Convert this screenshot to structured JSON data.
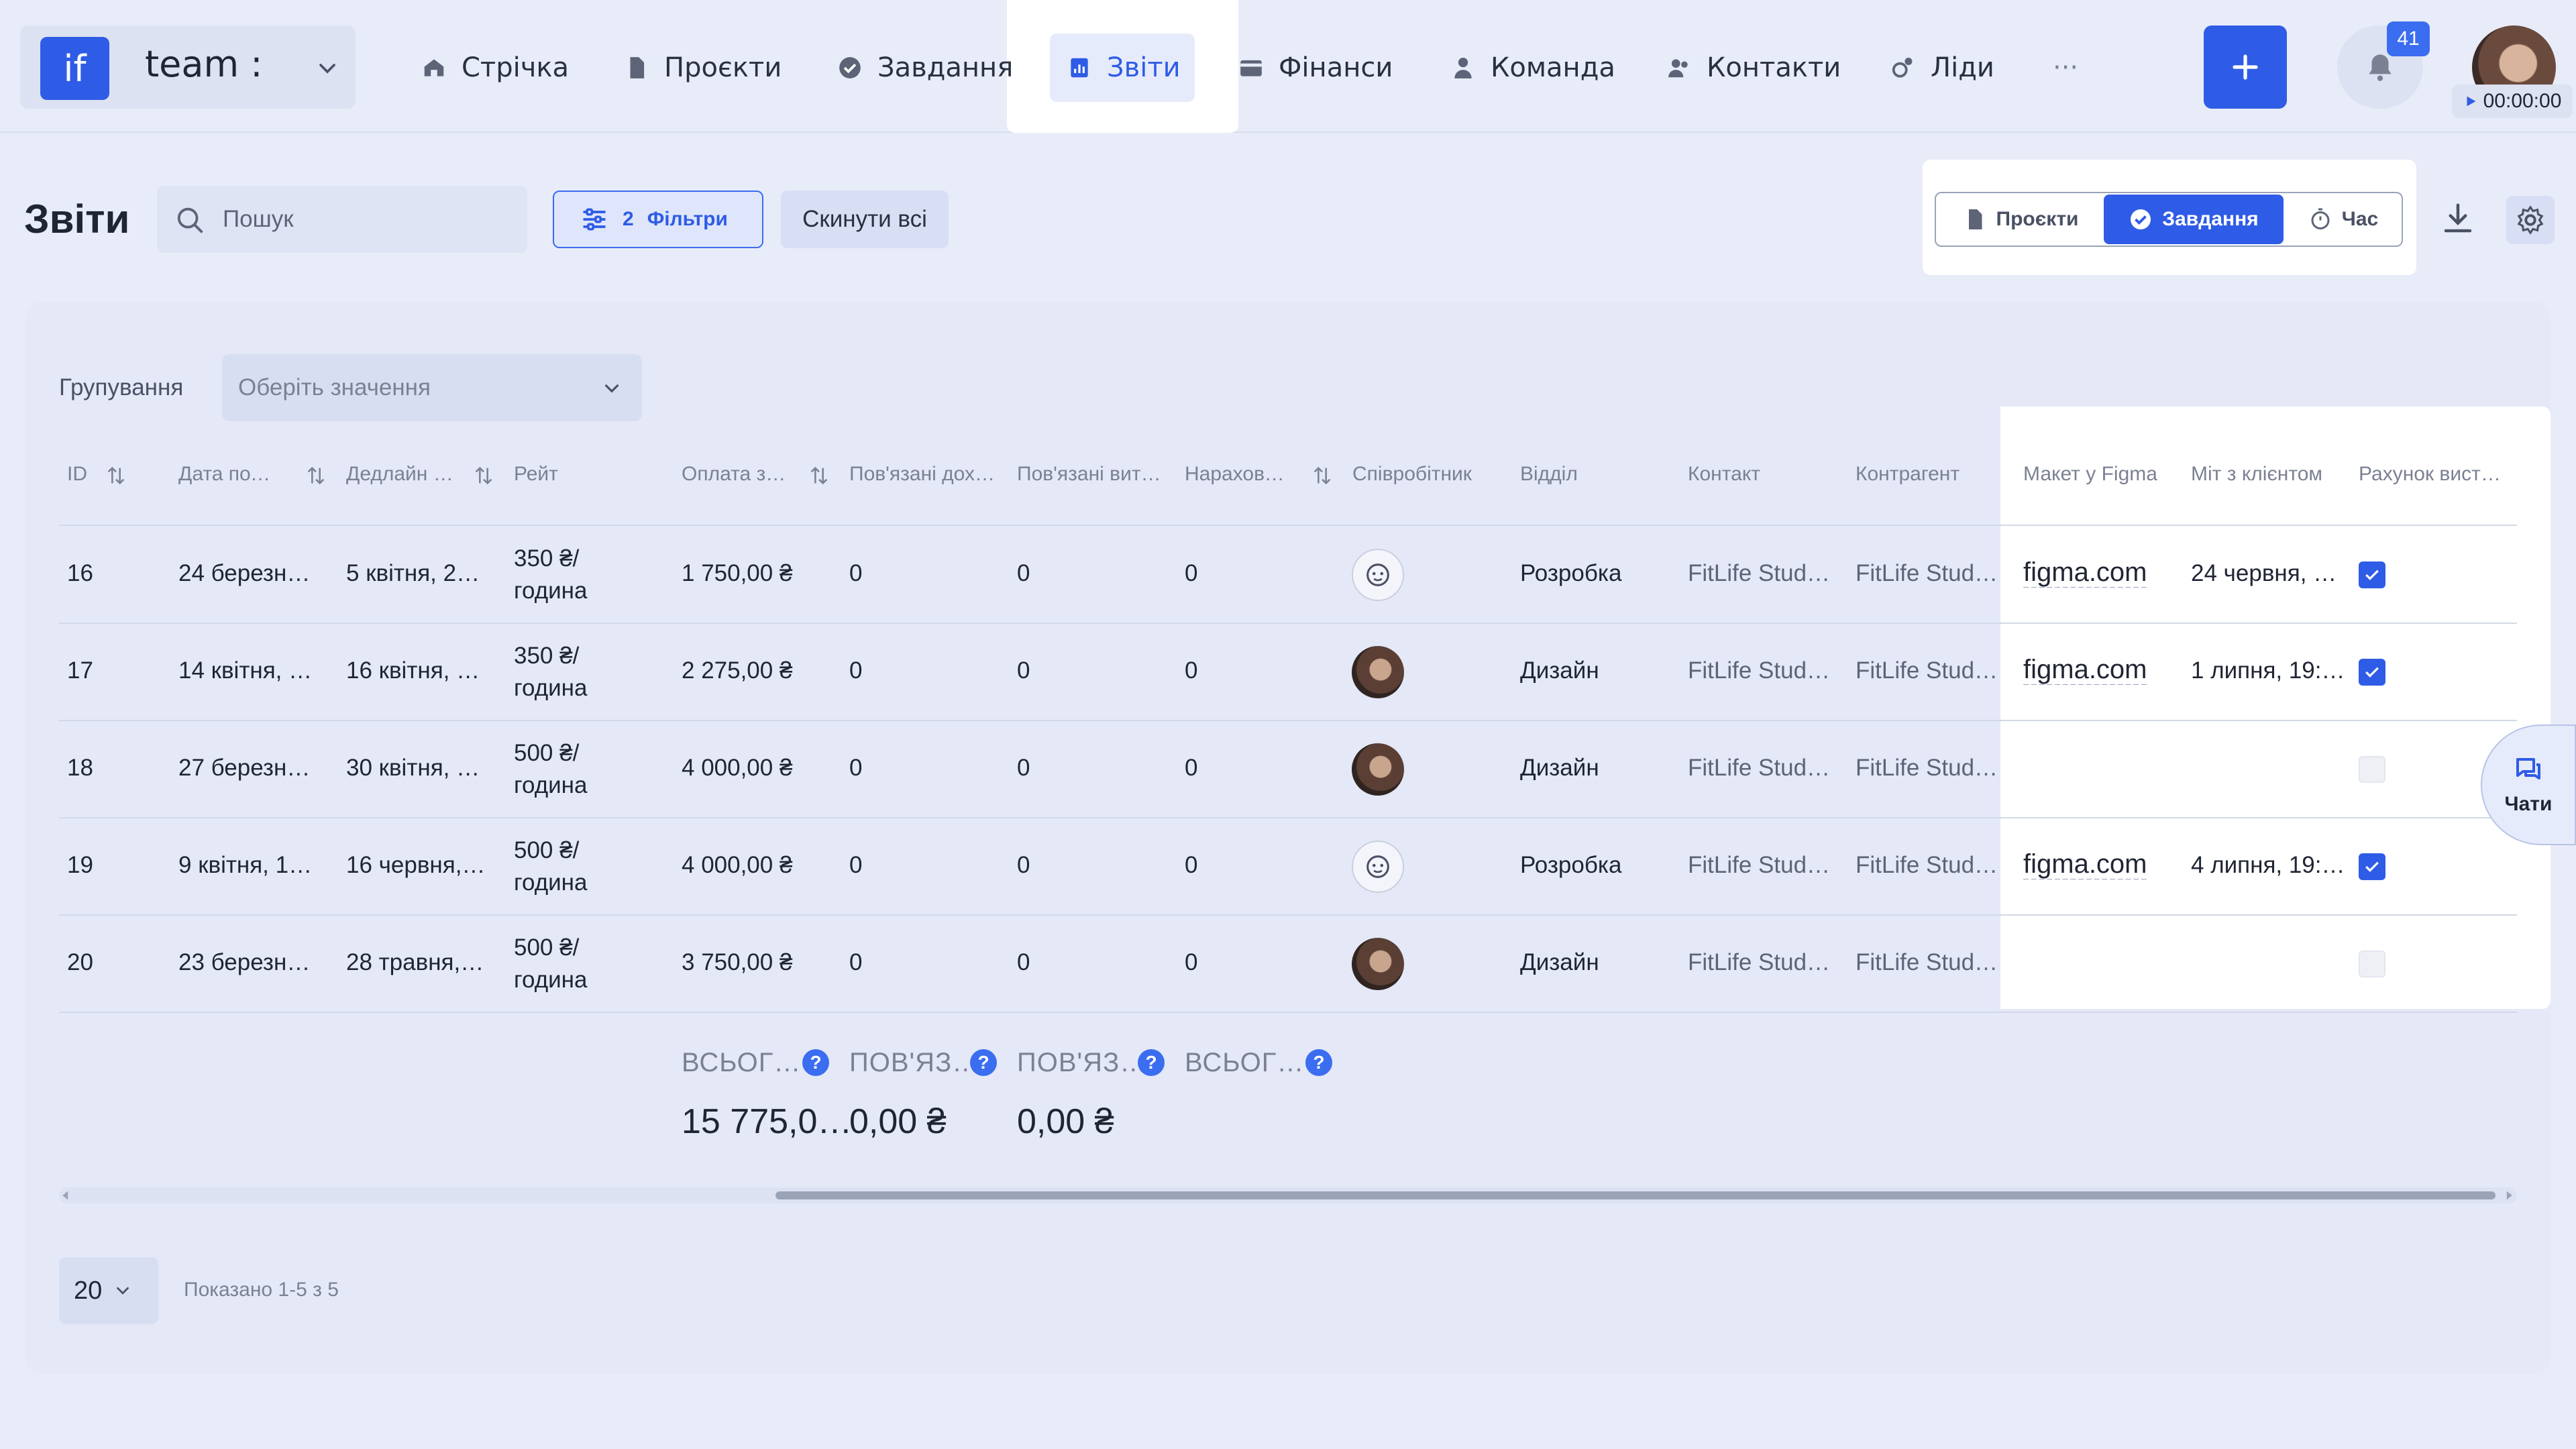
{
  "app": {
    "logo_text": "if",
    "team_name": "team :"
  },
  "nav": [
    {
      "label": "Стрічка",
      "icon": "home-icon"
    },
    {
      "label": "Проєкти",
      "icon": "document-icon"
    },
    {
      "label": "Завдання",
      "icon": "check-circle-icon"
    },
    {
      "label": "Звіти",
      "icon": "report-icon",
      "active": true
    },
    {
      "label": "Фінанси",
      "icon": "wallet-icon"
    },
    {
      "label": "Команда",
      "icon": "user-icon"
    },
    {
      "label": "Контакти",
      "icon": "contacts-icon"
    },
    {
      "label": "Ліди",
      "icon": "leads-icon"
    },
    {
      "label": "···",
      "icon": "more-icon"
    }
  ],
  "header": {
    "notifications_count": "41",
    "timer": "00:00:00"
  },
  "toolbar": {
    "title": "Звіти",
    "search_placeholder": "Пошук",
    "filters_count": "2",
    "filters_label": "Фільтри",
    "reset_label": "Скинути всі",
    "modes": [
      "Проєкти",
      "Завдання",
      "Час"
    ],
    "active_mode": "Завдання"
  },
  "grouping": {
    "label": "Групування",
    "placeholder": "Оберіть значення"
  },
  "table": {
    "columns": [
      "ID",
      "Дата поч…",
      "Дедлайн …",
      "Рейт",
      "Оплата з…",
      "Пов'язані дох…",
      "Пов'язані вит…",
      "Нарахова…",
      "Співробітник",
      "Відділ",
      "Контакт",
      "Контрагент",
      "Макет у Figma",
      "Міт з клієнтом",
      "Рахунок вист…"
    ],
    "rows": [
      {
        "id": "16",
        "start": "24 березня…",
        "deadline": "5 квітня, 2…",
        "rate1": "350 ₴/",
        "rate2": "година",
        "payment": "1 750,00 ₴",
        "income": "0",
        "expense": "0",
        "accrued": "0",
        "employee": "icon",
        "dept": "Розробка",
        "contact": "FitLife Stud…",
        "counterparty": "FitLife Stud…",
        "figma": "figma.com",
        "meeting": "24 червня, 1…",
        "invoiced": true
      },
      {
        "id": "17",
        "start": "14 квітня, 1…",
        "deadline": "16 квітня, 2…",
        "rate1": "350 ₴/",
        "rate2": "година",
        "payment": "2 275,00 ₴",
        "income": "0",
        "expense": "0",
        "accrued": "0",
        "employee": "photo",
        "dept": "Дизайн",
        "contact": "FitLife Stud…",
        "counterparty": "FitLife Stud…",
        "figma": "figma.com",
        "meeting": "1 липня, 19:…",
        "invoiced": true
      },
      {
        "id": "18",
        "start": "27 березня…",
        "deadline": "30 квітня, …",
        "rate1": "500 ₴/",
        "rate2": "година",
        "payment": "4 000,00 ₴",
        "income": "0",
        "expense": "0",
        "accrued": "0",
        "employee": "photo",
        "dept": "Дизайн",
        "contact": "FitLife Stud…",
        "counterparty": "FitLife Stud…",
        "figma": "",
        "meeting": "",
        "invoiced": false
      },
      {
        "id": "19",
        "start": "9 квітня, 16…",
        "deadline": "16 червня, …",
        "rate1": "500 ₴/",
        "rate2": "година",
        "payment": "4 000,00 ₴",
        "income": "0",
        "expense": "0",
        "accrued": "0",
        "employee": "icon",
        "dept": "Розробка",
        "contact": "FitLife Stud…",
        "counterparty": "FitLife Stud…",
        "figma": "figma.com",
        "meeting": "4 липня, 19:…",
        "invoiced": true
      },
      {
        "id": "20",
        "start": "23 березня…",
        "deadline": "28 травня, …",
        "rate1": "500 ₴/",
        "rate2": "година",
        "payment": "3 750,00 ₴",
        "income": "0",
        "expense": "0",
        "accrued": "0",
        "employee": "photo",
        "dept": "Дизайн",
        "contact": "FitLife Stud…",
        "counterparty": "FitLife Stud…",
        "figma": "",
        "meeting": "",
        "invoiced": false
      }
    ],
    "totals": [
      {
        "label": "ВСЬОГ…",
        "value": "15 775,0…"
      },
      {
        "label": "ПОВ'ЯЗ…",
        "value": "0,00 ₴"
      },
      {
        "label": "ПОВ'ЯЗ…",
        "value": "0,00 ₴"
      },
      {
        "label": "ВСЬОГ…",
        "value": ""
      }
    ]
  },
  "pagination": {
    "page_size": "20",
    "shown": "Показано 1-5 з 5"
  },
  "chats": {
    "label": "Чати"
  },
  "colors": {
    "accent": "#2f5ce6",
    "background": "#e8ecf8"
  }
}
